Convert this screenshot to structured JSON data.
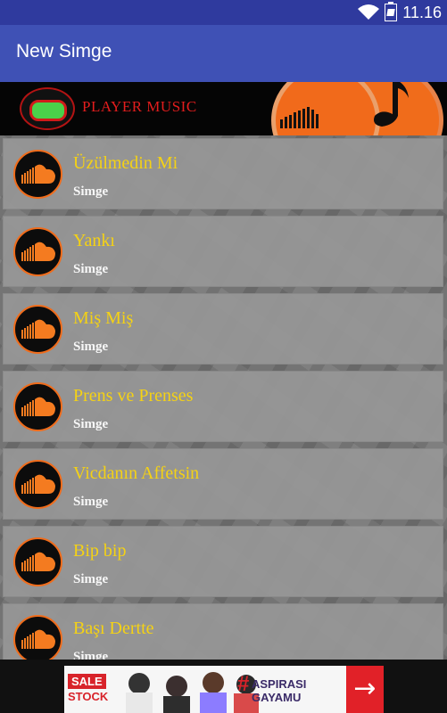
{
  "status_bar": {
    "time": "11.16"
  },
  "app_bar": {
    "title": "New Simge"
  },
  "banner": {
    "text": "PLAYER MUSIC"
  },
  "songs": [
    {
      "title": "Üzülmedin Mi",
      "artist": "Simge"
    },
    {
      "title": "Yankı",
      "artist": "Simge"
    },
    {
      "title": "Miş Miş",
      "artist": "Simge"
    },
    {
      "title": "Prens ve Prenses",
      "artist": "Simge"
    },
    {
      "title": "Vicdanın Affetsin",
      "artist": "Simge"
    },
    {
      "title": "Bip bip",
      "artist": "Simge"
    },
    {
      "title": "Başı Dertte",
      "artist": "Simge"
    }
  ],
  "ad": {
    "sale": "SALE",
    "stock": "STOCK",
    "brand_line1": "ASPIRASI",
    "brand_line2": "GAYAMU",
    "hash": "#"
  },
  "icons": {
    "wifi": "wifi-icon",
    "battery": "battery-icon",
    "song_thumb": "soundcloud-icon",
    "arrow": "arrow-right-icon"
  },
  "colors": {
    "status_bar": "#2f3a9e",
    "app_bar": "#3f51b5",
    "song_title": "#f5d214",
    "thumb_ring": "#f06c1b",
    "ad_accent": "#d8232a"
  }
}
